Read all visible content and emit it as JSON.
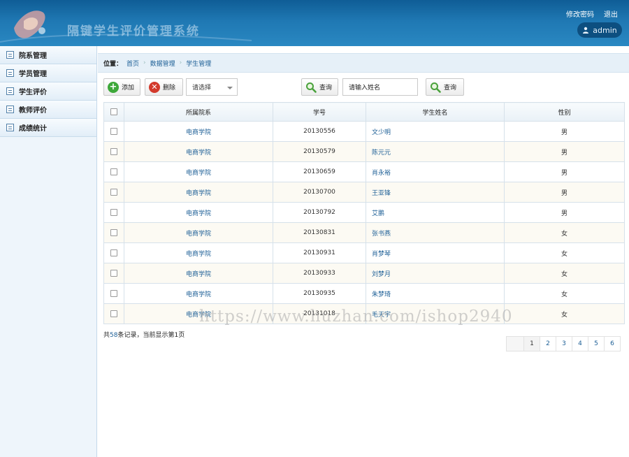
{
  "header": {
    "system_title": "隔键学生评价管理系统",
    "change_password": "修改密码",
    "logout": "退出",
    "user": "admin"
  },
  "sidebar": {
    "items": [
      {
        "label": "院系管理"
      },
      {
        "label": "学员管理"
      },
      {
        "label": "学生评价"
      },
      {
        "label": "教师评价"
      },
      {
        "label": "成绩统计"
      }
    ]
  },
  "breadcrumb": {
    "position_label": "位置：",
    "items": [
      "首页",
      "数据管理",
      "学生管理"
    ]
  },
  "toolbar": {
    "add_label": "添加",
    "delete_label": "删除",
    "select_value": "请选择",
    "query_label": "查询",
    "name_placeholder": "请输入姓名",
    "query2_label": "查询"
  },
  "table": {
    "headers": [
      "所属院系",
      "学号",
      "学生姓名",
      "性别"
    ],
    "rows": [
      {
        "dept": "电商学院",
        "id": "20130556",
        "name": "文少明",
        "gender": "男"
      },
      {
        "dept": "电商学院",
        "id": "20130579",
        "name": "陈元元",
        "gender": "男"
      },
      {
        "dept": "电商学院",
        "id": "20130659",
        "name": "肖永裕",
        "gender": "男"
      },
      {
        "dept": "电商学院",
        "id": "20130700",
        "name": "王亚锋",
        "gender": "男"
      },
      {
        "dept": "电商学院",
        "id": "20130792",
        "name": "艾鹏",
        "gender": "男"
      },
      {
        "dept": "电商学院",
        "id": "20130831",
        "name": "张书燕",
        "gender": "女"
      },
      {
        "dept": "电商学院",
        "id": "20130931",
        "name": "肖梦琴",
        "gender": "女"
      },
      {
        "dept": "电商学院",
        "id": "20130933",
        "name": "刘梦月",
        "gender": "女"
      },
      {
        "dept": "电商学院",
        "id": "20130935",
        "name": "朱梦琦",
        "gender": "女"
      },
      {
        "dept": "电商学院",
        "id": "20131018",
        "name": "毛天宇",
        "gender": "女"
      }
    ]
  },
  "summary": {
    "prefix": "共",
    "total": "58",
    "mid": "条记录，当前显示第",
    "current": "1",
    "suffix": "页"
  },
  "pager": {
    "pages": [
      "1",
      "2",
      "3",
      "4",
      "5",
      "6"
    ]
  },
  "watermark": "https://www.huzhan.com/ishop2940",
  "colors": {
    "header_blue": "#1f78b3",
    "link_blue": "#1d5f96",
    "add_green": "#3ea83a",
    "delete_red": "#d33a2c"
  },
  "icons": [
    "user-icon",
    "menu-list-icon",
    "plus-circle-icon",
    "delete-circle-icon",
    "search-icon",
    "dropdown-caret-icon",
    "checkbox-icon"
  ]
}
